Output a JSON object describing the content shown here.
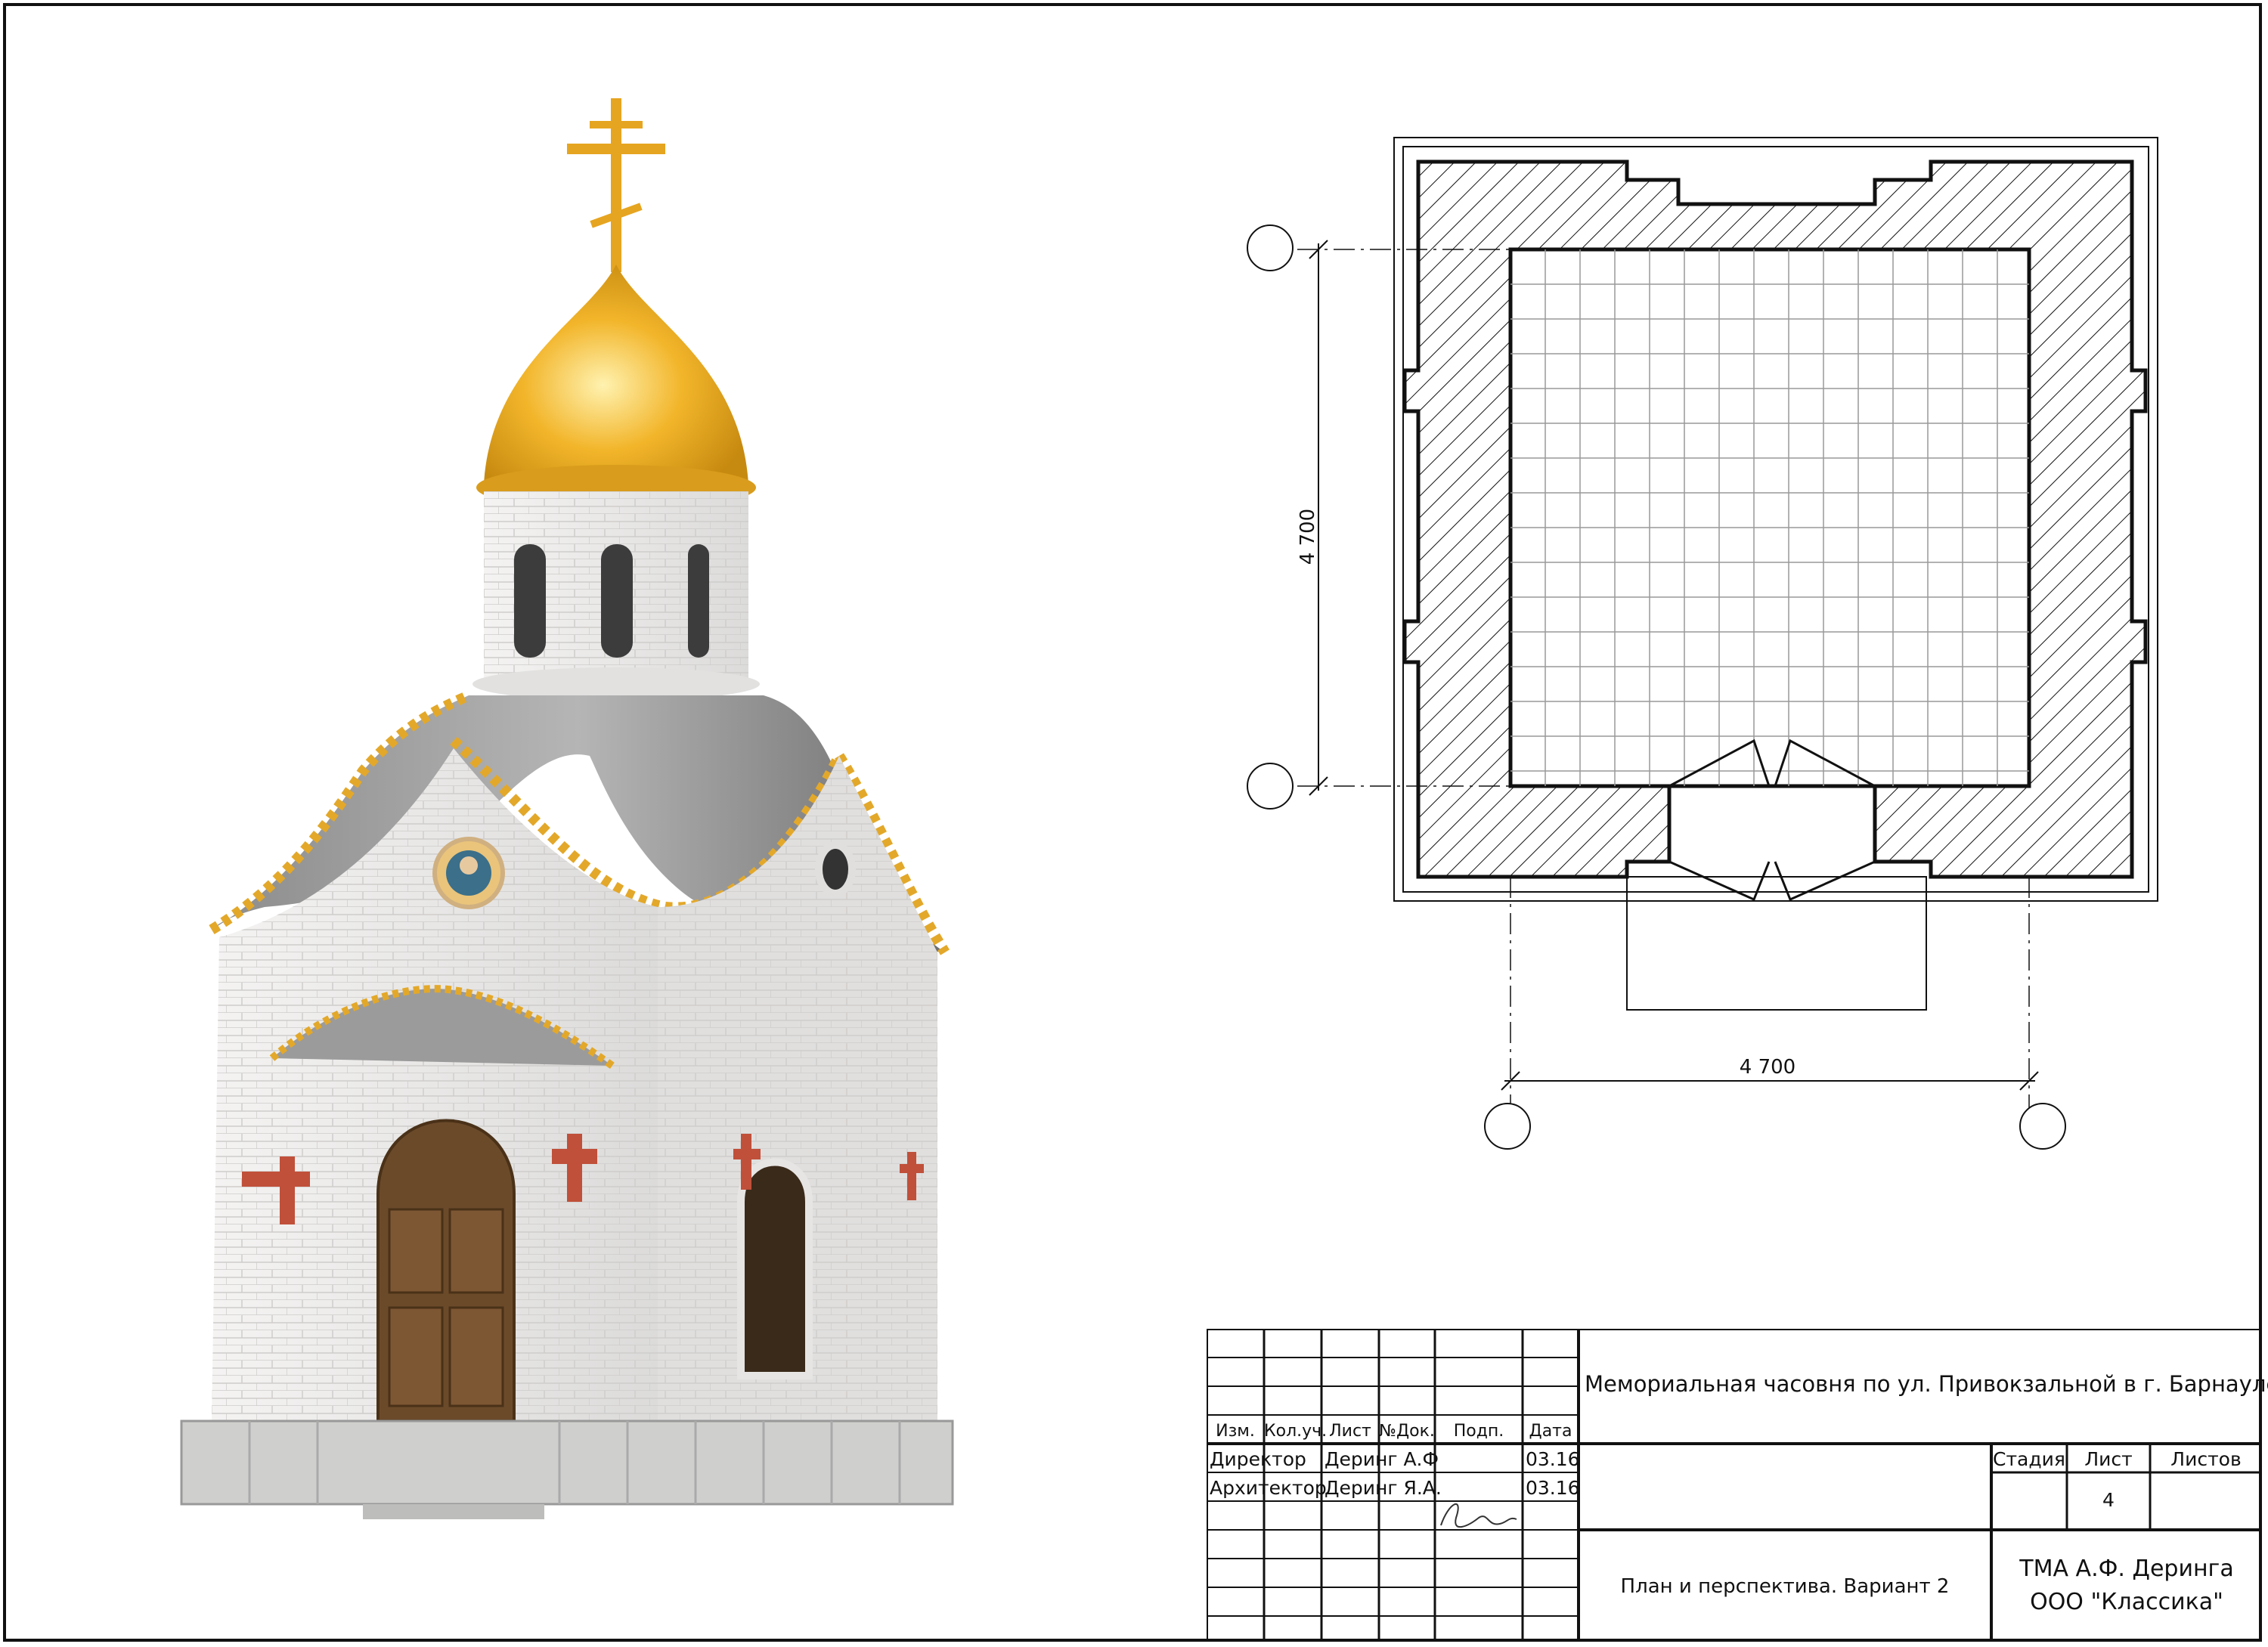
{
  "plan": {
    "dim_vertical": "4 700",
    "dim_horizontal": "4 700"
  },
  "title_block": {
    "headers": {
      "izm": "Изм.",
      "kol": "Кол.уч.",
      "list": "Лист",
      "doc": "№Док.",
      "podp": "Подп.",
      "data": "Дата"
    },
    "rows": [
      {
        "role": "Директор",
        "name": "Деринг А.Ф",
        "date": "03.16"
      },
      {
        "role": "Архитектор",
        "name": "Деринг Я.А.",
        "date": "03.16"
      }
    ],
    "project_title": "Мемориальная часовня по ул. Привокзальной в г. Барнауле",
    "stage_label": "Стадия",
    "sheet_label": "Лист",
    "sheets_label": "Листов",
    "sheet_number": "4",
    "drawing_name": "План и перспектива. Вариант 2",
    "org_line1": "ТМА А.Ф. Деринга",
    "org_line2": "ООО \"Классика\""
  },
  "colors": {
    "line": "#111111",
    "gold": "#e8a81c",
    "roof": "#9a9a9a",
    "wall": "#ecebea",
    "door": "#6b4a2a",
    "cross_red": "#c0503a"
  }
}
